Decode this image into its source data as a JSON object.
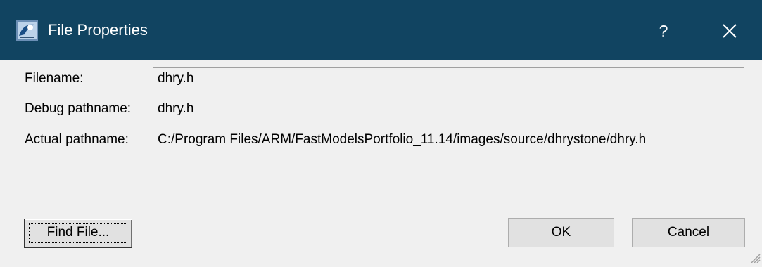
{
  "window": {
    "title": "File Properties",
    "help_label": "?",
    "colors": {
      "titlebar": "#114461",
      "background": "#f0f0f0"
    }
  },
  "fields": {
    "filename": {
      "label": "Filename:",
      "value": "dhry.h"
    },
    "debug_pathname": {
      "label": "Debug pathname:",
      "value": "dhry.h"
    },
    "actual_pathname": {
      "label": "Actual pathname:",
      "value": "C:/Program Files/ARM/FastModelsPortfolio_11.14/images/source/dhrystone/dhry.h"
    }
  },
  "buttons": {
    "find_file": "Find File...",
    "ok": "OK",
    "cancel": "Cancel"
  },
  "icons": [
    "app-icon",
    "help-icon",
    "close-icon",
    "resize-grip-icon"
  ]
}
